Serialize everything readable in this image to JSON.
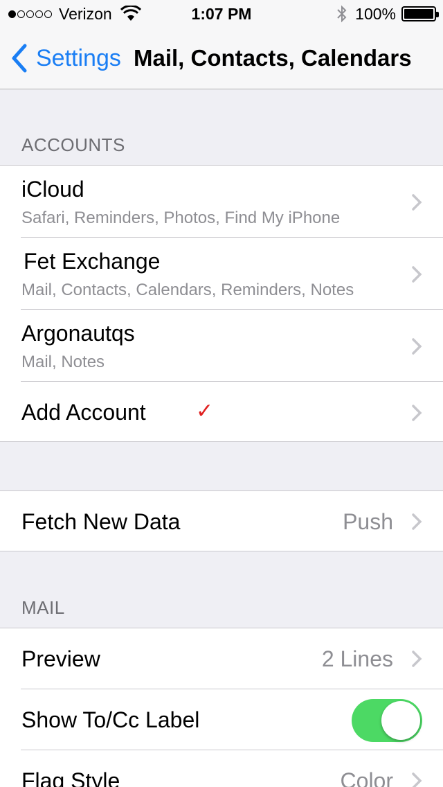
{
  "status_bar": {
    "carrier": "Verizon",
    "time": "1:07 PM",
    "battery": "100%",
    "battery_level": 1.0,
    "signal_bars_filled": 1
  },
  "nav": {
    "back_label": "Settings",
    "title": "Mail, Contacts, Calendars"
  },
  "accounts": {
    "header": "ACCOUNTS",
    "items": [
      {
        "title": "iCloud",
        "subtitle": "Safari, Reminders, Photos, Find My iPhone"
      },
      {
        "title": "Fet Exchange",
        "subtitle": "Mail, Contacts, Calendars, Reminders, Notes"
      },
      {
        "title": "Argonautqs",
        "subtitle": "Mail, Notes"
      }
    ],
    "add_account": "Add Account",
    "checkmark": "✓"
  },
  "fetch": {
    "label": "Fetch New Data",
    "value": "Push"
  },
  "mail": {
    "header": "MAIL",
    "preview_label": "Preview",
    "preview_value": "2 Lines",
    "show_tocc_label": "Show To/Cc Label",
    "show_tocc_on": true,
    "flag_style_label": "Flag Style",
    "flag_style_value": "Color"
  },
  "colors": {
    "accent": "#1a7ef4",
    "toggle_on": "#4cd964",
    "checkmark": "#e02020"
  }
}
